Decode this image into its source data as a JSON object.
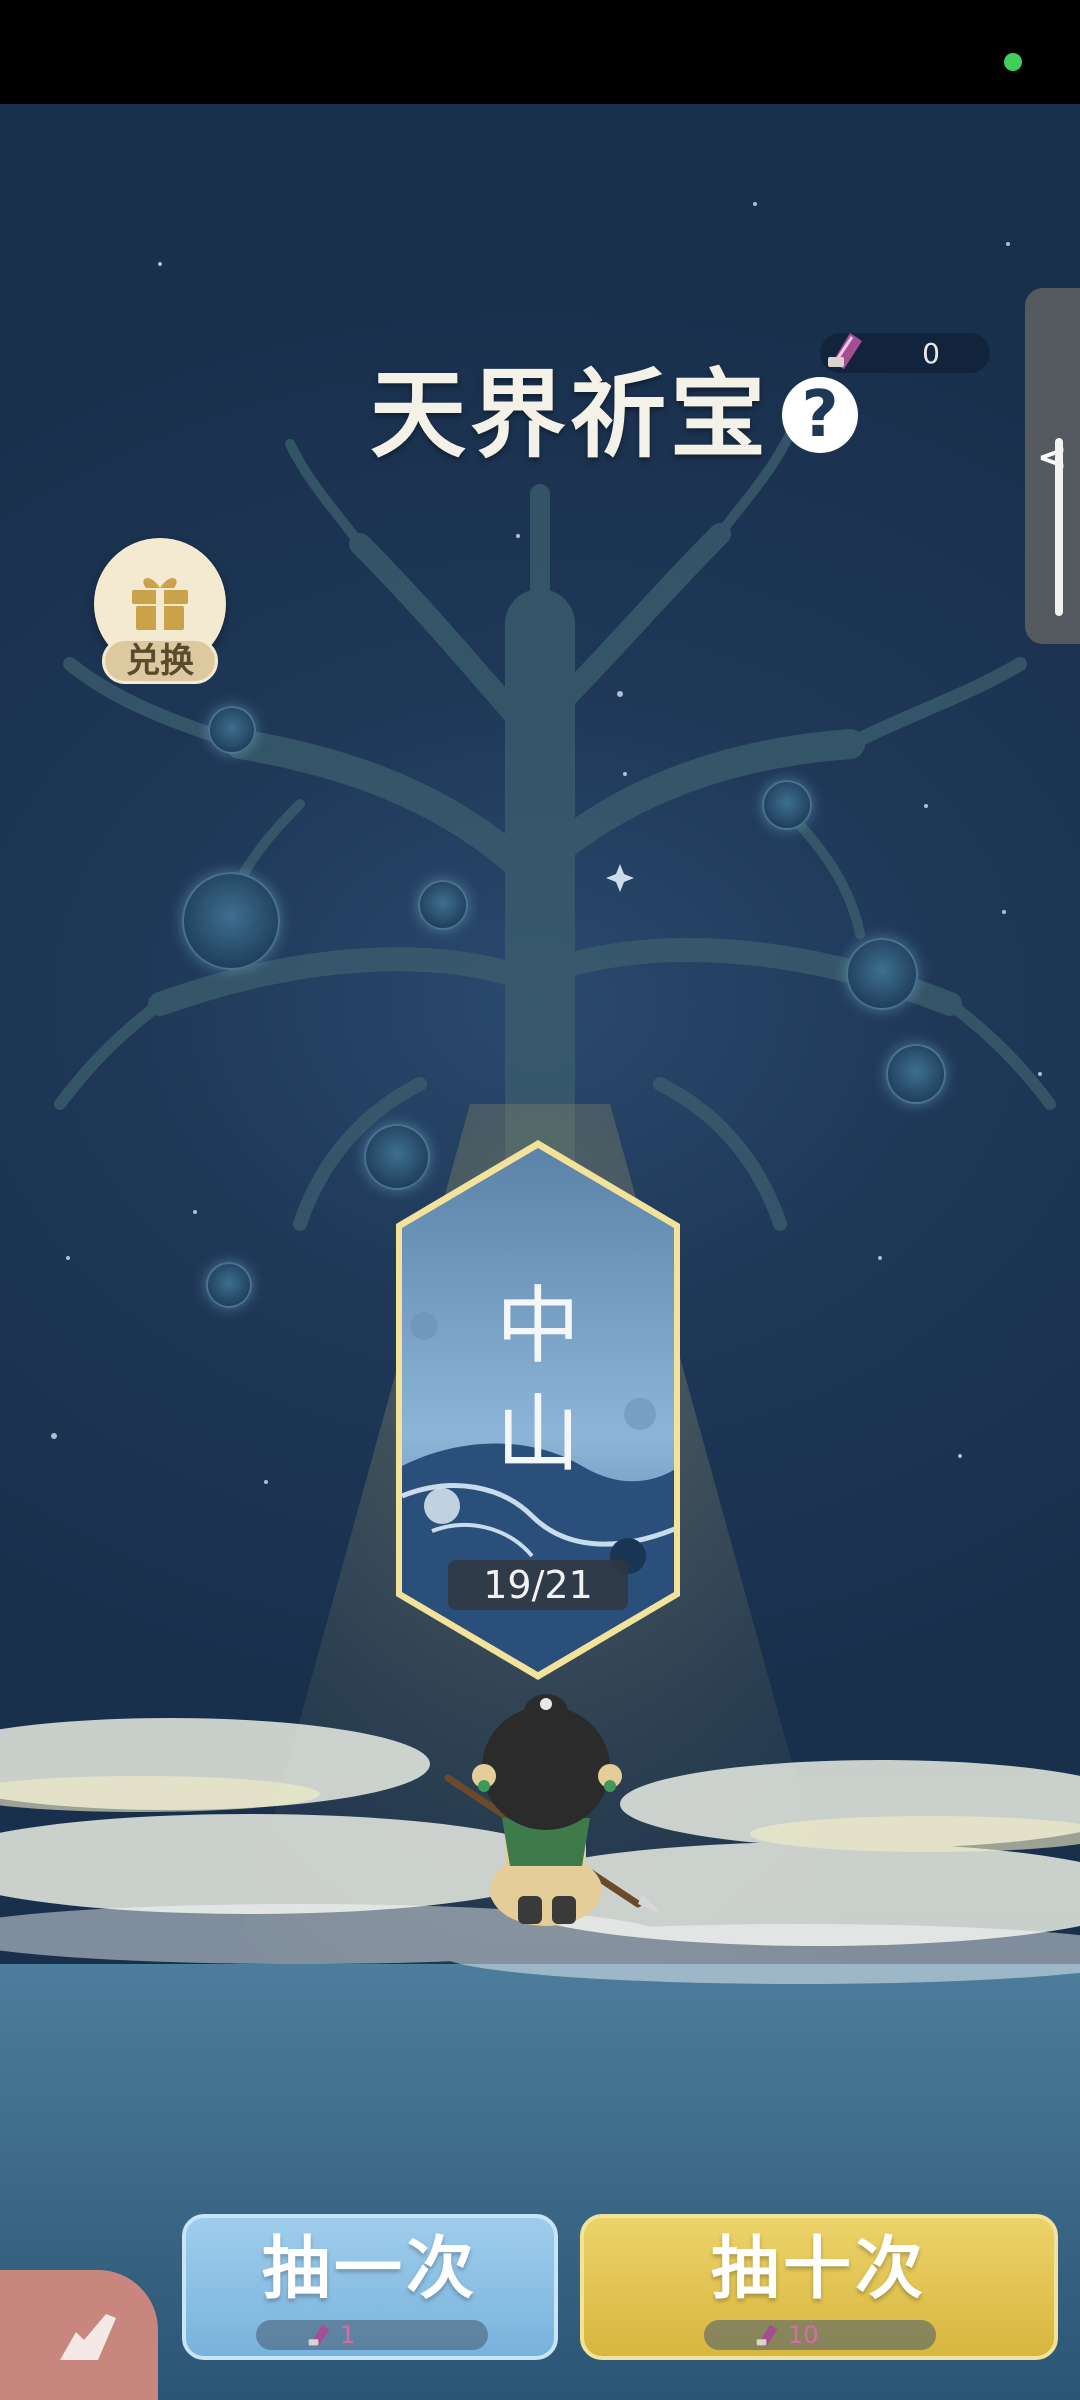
{
  "header": {
    "title": "天界祈宝"
  },
  "currency": {
    "amount": "0"
  },
  "exchange": {
    "label": "兑换"
  },
  "card": {
    "name_line1": "中",
    "name_line2": "山",
    "progress_text": "19/21",
    "progress": {
      "collected": 19,
      "total": 21
    }
  },
  "actions": {
    "draw_once": {
      "label": "抽一次",
      "cost": "1"
    },
    "draw_ten": {
      "label": "抽十次",
      "cost": "10"
    }
  },
  "icons": [
    "help-icon",
    "ticket-icon",
    "gift-icon",
    "collapse-arrow-icon",
    "spirit-orb-icon",
    "diamond-orb-icon",
    "hero-character",
    "corner-menu-icon"
  ],
  "colors": {
    "card_border": "#f3e39a",
    "draw_once": "#8cc2e6",
    "draw_ten": "#e4c654",
    "sky": "#1e3554"
  }
}
